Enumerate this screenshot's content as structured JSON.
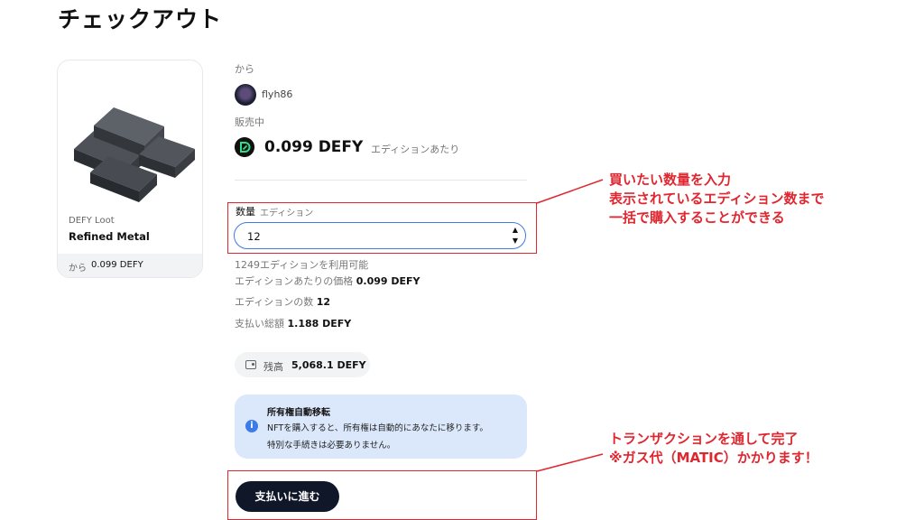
{
  "page": {
    "title": "チェックアウト"
  },
  "card": {
    "collection": "DEFY Loot",
    "name": "Refined Metal",
    "from_label": "から",
    "from_price": "0.099 DEFY",
    "image_icon": "metal-ingots-image"
  },
  "seller": {
    "from_label": "から",
    "name": "flyh86"
  },
  "sale": {
    "label": "販売中",
    "price": "0.099 DEFY",
    "per_edition": "エディションあたり"
  },
  "quantity": {
    "label": "数量",
    "sublabel": "エディション",
    "value": "12"
  },
  "info": {
    "available": "1249エディションを利用可能",
    "unit_price_label": "エディションあたりの価格",
    "unit_price_value": "0.099 DEFY",
    "count_label": "エディションの数",
    "count_value": "12",
    "total_label": "支払い総額",
    "total_value": "1.188 DEFY"
  },
  "balance": {
    "label": "残高",
    "value": "5,068.1 DEFY",
    "icon": "wallet-icon"
  },
  "notice": {
    "title": "所有権自動移転",
    "body_line1": "NFTを購入すると、所有権は自動的にあなたに移ります。",
    "body_line2": "特別な手続きは必要ありません。",
    "icon_glyph": "i"
  },
  "pay_button": {
    "label": "支払いに進む"
  },
  "annotations": {
    "quantity_callout": [
      "買いたい数量を入力",
      "表示されているエディション数まで",
      "一括で購入することができる"
    ],
    "payment_callout": [
      "トランザクションを通して完了",
      "※ガス代（MATIC）かかります！"
    ]
  },
  "colors": {
    "accent": "#3d7be8",
    "highlight": "#e0262f",
    "button": "#0f1729",
    "notice_bg": "#dbe8fb"
  }
}
